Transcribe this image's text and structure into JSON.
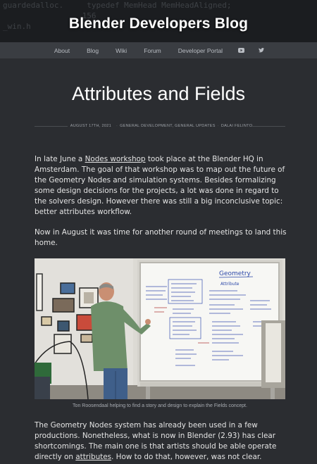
{
  "header": {
    "site_title": "Blender Developers Blog",
    "code_lines": [
      "guardedalloc.     typedef MemHead MemHeadAligned;",
      "                 156",
      "_win.h"
    ]
  },
  "nav": {
    "items": [
      {
        "label": "About"
      },
      {
        "label": "Blog"
      },
      {
        "label": "Wiki"
      },
      {
        "label": "Forum"
      },
      {
        "label": "Developer Portal"
      }
    ],
    "icons": [
      "youtube-icon",
      "twitter-icon"
    ]
  },
  "post": {
    "title": "Attributes and Fields",
    "date": "AUGUST 17TH, 2021",
    "categories": "GENERAL DEVELOPMENT, GENERAL UPDATES",
    "author": "DALAI FELINTO",
    "para1_before": "In late June a ",
    "para1_link": "Nodes workshop",
    "para1_after": " took place at the Blender HQ in Amsterdam. The goal of that workshop was to map out the future of the Geometry Nodes and simulation systems. Besides formalizing some design decisions for the projects, a lot was done in regard to the solvers design. However there was still a big inconclusive topic: better attributes workflow.",
    "para2": "Now in August it was time for another round of meetings to land this home.",
    "caption": "Ton Roosendaal helping to find a story and design to explain the Fields concept.",
    "para3_before": "The Geometry Nodes system has already been used in a few productions. Nonetheless, what is now in Blender (2.93) has clear shortcomings. The main one is that artists should be able operate directly on ",
    "para3_link": "attributes",
    "para3_after": ". How to do that, however, was not clear."
  },
  "whiteboard": {
    "heading": "Geometry",
    "subheading": "Attribute"
  },
  "colors": {
    "background": "#2b2d31",
    "header": "#1b1d20",
    "nav": "#3a3d42",
    "text": "#e4e4e4"
  }
}
